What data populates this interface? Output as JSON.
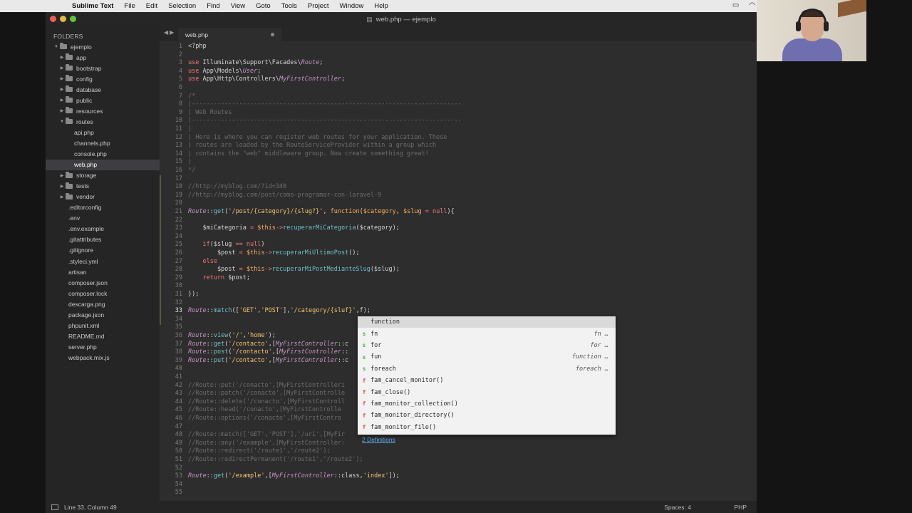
{
  "menubar": {
    "app": "Sublime Text",
    "items": [
      "File",
      "Edit",
      "Selection",
      "Find",
      "View",
      "Goto",
      "Tools",
      "Project",
      "Window",
      "Help"
    ]
  },
  "window": {
    "title": "web.php — ejemplo"
  },
  "sidebar": {
    "header": "FOLDERS",
    "items": [
      {
        "label": "ejemplo",
        "type": "folder",
        "depth": 0,
        "open": true
      },
      {
        "label": "app",
        "type": "folder",
        "depth": 1
      },
      {
        "label": "bootstrap",
        "type": "folder",
        "depth": 1
      },
      {
        "label": "config",
        "type": "folder",
        "depth": 1
      },
      {
        "label": "database",
        "type": "folder",
        "depth": 1
      },
      {
        "label": "public",
        "type": "folder",
        "depth": 1
      },
      {
        "label": "resources",
        "type": "folder",
        "depth": 1
      },
      {
        "label": "routes",
        "type": "folder",
        "depth": 1,
        "open": true
      },
      {
        "label": "api.php",
        "type": "file",
        "depth": 2
      },
      {
        "label": "channels.php",
        "type": "file",
        "depth": 2
      },
      {
        "label": "console.php",
        "type": "file",
        "depth": 2
      },
      {
        "label": "web.php",
        "type": "file",
        "depth": 2,
        "selected": true
      },
      {
        "label": "storage",
        "type": "folder",
        "depth": 1
      },
      {
        "label": "tests",
        "type": "folder",
        "depth": 1
      },
      {
        "label": "vendor",
        "type": "folder",
        "depth": 1
      },
      {
        "label": ".editorconfig",
        "type": "file",
        "depth": 1
      },
      {
        "label": ".env",
        "type": "file",
        "depth": 1
      },
      {
        "label": ".env.example",
        "type": "file",
        "depth": 1
      },
      {
        "label": ".gitattributes",
        "type": "file",
        "depth": 1
      },
      {
        "label": ".gitignore",
        "type": "file",
        "depth": 1
      },
      {
        "label": ".styleci.yml",
        "type": "file",
        "depth": 1
      },
      {
        "label": "artisan",
        "type": "file",
        "depth": 1
      },
      {
        "label": "composer.json",
        "type": "file",
        "depth": 1
      },
      {
        "label": "composer.lock",
        "type": "file",
        "depth": 1
      },
      {
        "label": "descarga.png",
        "type": "file",
        "depth": 1
      },
      {
        "label": "package.json",
        "type": "file",
        "depth": 1
      },
      {
        "label": "phpunit.xml",
        "type": "file",
        "depth": 1
      },
      {
        "label": "README.md",
        "type": "file",
        "depth": 1
      },
      {
        "label": "server.php",
        "type": "file",
        "depth": 1
      },
      {
        "label": "webpack.mix.js",
        "type": "file",
        "depth": 1
      }
    ]
  },
  "tabs": [
    {
      "label": "web.php",
      "active": true,
      "dirty": true
    }
  ],
  "editor": {
    "current_line": 33,
    "lines": [
      {
        "n": 1,
        "tokens": [
          [
            "op",
            "<?php"
          ]
        ]
      },
      {
        "n": 2,
        "tokens": []
      },
      {
        "n": 3,
        "tokens": [
          [
            "kw",
            "use "
          ],
          [
            "op",
            "Illuminate\\Support\\Facades\\"
          ],
          [
            "cls",
            "Route"
          ],
          [
            "op",
            ";"
          ]
        ]
      },
      {
        "n": 4,
        "tokens": [
          [
            "kw",
            "use "
          ],
          [
            "op",
            "App\\Models\\"
          ],
          [
            "cls",
            "User"
          ],
          [
            "op",
            ";"
          ]
        ]
      },
      {
        "n": 5,
        "tokens": [
          [
            "kw",
            "use "
          ],
          [
            "op",
            "App\\Http\\Controllers\\"
          ],
          [
            "cls",
            "MyFirstController"
          ],
          [
            "op",
            ";"
          ]
        ]
      },
      {
        "n": 6,
        "tokens": []
      },
      {
        "n": 7,
        "tokens": [
          [
            "cm",
            "/*"
          ]
        ]
      },
      {
        "n": 8,
        "tokens": [
          [
            "cm",
            "|--------------------------------------------------------------------------"
          ]
        ]
      },
      {
        "n": 9,
        "tokens": [
          [
            "cm",
            "| Web Routes"
          ]
        ]
      },
      {
        "n": 10,
        "tokens": [
          [
            "cm",
            "|--------------------------------------------------------------------------"
          ]
        ]
      },
      {
        "n": 11,
        "tokens": [
          [
            "cm",
            "|"
          ]
        ]
      },
      {
        "n": 12,
        "tokens": [
          [
            "cm",
            "| Here is where you can register web routes for your application. These"
          ]
        ]
      },
      {
        "n": 13,
        "tokens": [
          [
            "cm",
            "| routes are loaded by the RouteServiceProvider within a group which"
          ]
        ]
      },
      {
        "n": 14,
        "tokens": [
          [
            "cm",
            "| contains the \"web\" middleware group. Now create something great!"
          ]
        ]
      },
      {
        "n": 15,
        "tokens": [
          [
            "cm",
            "|"
          ]
        ]
      },
      {
        "n": 16,
        "tokens": [
          [
            "cm",
            "*/"
          ]
        ]
      },
      {
        "n": 17,
        "tokens": []
      },
      {
        "n": 18,
        "tokens": [
          [
            "cm",
            "//http://myblog.com/?id=340"
          ]
        ]
      },
      {
        "n": 19,
        "tokens": [
          [
            "cm",
            "//http://myblog.com/post/como-programar-con-laravel-9"
          ]
        ]
      },
      {
        "n": 20,
        "tokens": []
      },
      {
        "n": 21,
        "tokens": [
          [
            "cls",
            "Route"
          ],
          [
            "op",
            "::"
          ],
          [
            "fn",
            "get"
          ],
          [
            "op",
            "("
          ],
          [
            "str",
            "'/post/{category}/{slug?}'"
          ],
          [
            "op",
            ", "
          ],
          [
            "var",
            "function"
          ],
          [
            "op",
            "("
          ],
          [
            "var",
            "$category"
          ],
          [
            "op",
            ", "
          ],
          [
            "var",
            "$slug"
          ],
          [
            "kw",
            " = "
          ],
          [
            "kw",
            "null"
          ],
          [
            "op",
            "){"
          ]
        ]
      },
      {
        "n": 22,
        "tokens": []
      },
      {
        "n": 23,
        "tokens": [
          [
            "op",
            "    $miCategoria "
          ],
          [
            "kw",
            "= "
          ],
          [
            "var",
            "$this"
          ],
          [
            "kw",
            "->"
          ],
          [
            "fn",
            "recuperarMiCategoria"
          ],
          [
            "op",
            "($category);"
          ]
        ]
      },
      {
        "n": 24,
        "tokens": []
      },
      {
        "n": 25,
        "tokens": [
          [
            "kw",
            "    if"
          ],
          [
            "op",
            "($slug "
          ],
          [
            "kw",
            "== "
          ],
          [
            "kw",
            "null"
          ],
          [
            "op",
            ")"
          ]
        ]
      },
      {
        "n": 26,
        "tokens": [
          [
            "op",
            "        $post "
          ],
          [
            "kw",
            "= "
          ],
          [
            "var",
            "$this"
          ],
          [
            "kw",
            "->"
          ],
          [
            "fn",
            "recuperarMiUltimoPost"
          ],
          [
            "op",
            "();"
          ]
        ]
      },
      {
        "n": 27,
        "tokens": [
          [
            "kw",
            "    else"
          ]
        ]
      },
      {
        "n": 28,
        "tokens": [
          [
            "op",
            "        $post "
          ],
          [
            "kw",
            "= "
          ],
          [
            "var",
            "$this"
          ],
          [
            "kw",
            "->"
          ],
          [
            "fn",
            "recuperarMiPostMedianteSlug"
          ],
          [
            "op",
            "($slug);"
          ]
        ]
      },
      {
        "n": 29,
        "tokens": [
          [
            "kw",
            "    return "
          ],
          [
            "op",
            "$post;"
          ]
        ]
      },
      {
        "n": 30,
        "tokens": []
      },
      {
        "n": 31,
        "tokens": [
          [
            "op",
            "});"
          ]
        ]
      },
      {
        "n": 32,
        "tokens": []
      },
      {
        "n": 33,
        "tokens": [
          [
            "cls",
            "Route"
          ],
          [
            "op",
            "::"
          ],
          [
            "fn",
            "match"
          ],
          [
            "op",
            "(["
          ],
          [
            "str",
            "'GET'"
          ],
          [
            "op",
            ","
          ],
          [
            "str",
            "'POST'"
          ],
          [
            "op",
            "],"
          ],
          [
            "str",
            "'/category/{sluf}'"
          ],
          [
            "op",
            ",f);"
          ]
        ]
      },
      {
        "n": 34,
        "tokens": []
      },
      {
        "n": 35,
        "tokens": []
      },
      {
        "n": 36,
        "tokens": [
          [
            "cls",
            "Route"
          ],
          [
            "op",
            "::"
          ],
          [
            "fn",
            "view"
          ],
          [
            "op",
            "("
          ],
          [
            "str",
            "'/'"
          ],
          [
            "op",
            ","
          ],
          [
            "str",
            "'home'"
          ],
          [
            "op",
            ");"
          ]
        ]
      },
      {
        "n": 37,
        "tokens": [
          [
            "cls",
            "Route"
          ],
          [
            "op",
            "::"
          ],
          [
            "fn",
            "get"
          ],
          [
            "op",
            "("
          ],
          [
            "str",
            "'/contacto'"
          ],
          [
            "op",
            ",["
          ],
          [
            "cls",
            "MyFirstController"
          ],
          [
            "op",
            "::c"
          ]
        ]
      },
      {
        "n": 38,
        "tokens": [
          [
            "cls",
            "Route"
          ],
          [
            "op",
            "::"
          ],
          [
            "fn",
            "post"
          ],
          [
            "op",
            "("
          ],
          [
            "str",
            "'/contacto'"
          ],
          [
            "op",
            ",["
          ],
          [
            "cls",
            "MyFirstController"
          ],
          [
            "op",
            "::"
          ]
        ]
      },
      {
        "n": 39,
        "tokens": [
          [
            "cls",
            "Route"
          ],
          [
            "op",
            "::"
          ],
          [
            "fn",
            "put"
          ],
          [
            "op",
            "("
          ],
          [
            "str",
            "'/contacto'"
          ],
          [
            "op",
            ",["
          ],
          [
            "cls",
            "MyFirstController"
          ],
          [
            "op",
            "::c"
          ]
        ]
      },
      {
        "n": 40,
        "tokens": []
      },
      {
        "n": 41,
        "tokens": []
      },
      {
        "n": 42,
        "tokens": [
          [
            "cm",
            "//Route::put('/conacto',[MyFirstControlleri"
          ]
        ]
      },
      {
        "n": 43,
        "tokens": [
          [
            "cm",
            "//Route::patch('/conacto',[MyFirstControlle"
          ]
        ]
      },
      {
        "n": 44,
        "tokens": [
          [
            "cm",
            "//Route::delete('/conacto',[MyFirstControll"
          ]
        ]
      },
      {
        "n": 45,
        "tokens": [
          [
            "cm",
            "//Route::head('/conacto',[MyFirstControlle"
          ]
        ]
      },
      {
        "n": 46,
        "tokens": [
          [
            "cm",
            "//Route::options('/conacto',[MyFirstContro"
          ]
        ]
      },
      {
        "n": 47,
        "tokens": []
      },
      {
        "n": 48,
        "tokens": [
          [
            "cm",
            "//Route::match(['GET','POST'],'/uri',[MyFir"
          ]
        ]
      },
      {
        "n": 49,
        "tokens": [
          [
            "cm",
            "//Route::any('/example',[MyFirstController:"
          ]
        ]
      },
      {
        "n": 50,
        "tokens": [
          [
            "cm",
            "//Route::redirect('/route1','/route2');"
          ]
        ]
      },
      {
        "n": 51,
        "tokens": [
          [
            "cm",
            "//Route::redirectPermanent('/route1','/route2');"
          ]
        ]
      },
      {
        "n": 52,
        "tokens": []
      },
      {
        "n": 53,
        "tokens": [
          [
            "cls",
            "Route"
          ],
          [
            "op",
            "::"
          ],
          [
            "fn",
            "get"
          ],
          [
            "op",
            "("
          ],
          [
            "str",
            "'/example'"
          ],
          [
            "op",
            ",["
          ],
          [
            "cls",
            "MyFirstController"
          ],
          [
            "op",
            "::class,"
          ],
          [
            "str",
            "'index'"
          ],
          [
            "op",
            "]);"
          ]
        ]
      },
      {
        "n": 54,
        "tokens": []
      },
      {
        "n": 55,
        "tokens": []
      }
    ]
  },
  "autocomplete": {
    "items": [
      {
        "kind": "",
        "name": "function",
        "hint": "",
        "selected": true
      },
      {
        "kind": "s",
        "name": "fn",
        "hint": "fn …"
      },
      {
        "kind": "s",
        "name": "for",
        "hint": "for …"
      },
      {
        "kind": "s",
        "name": "fun",
        "hint": "function …"
      },
      {
        "kind": "s",
        "name": "foreach",
        "hint": "foreach …"
      },
      {
        "kind": "f",
        "name": "fam_cancel_monitor()",
        "hint": ""
      },
      {
        "kind": "f",
        "name": "fam_close()",
        "hint": ""
      },
      {
        "kind": "f",
        "name": "fam_monitor_collection()",
        "hint": ""
      },
      {
        "kind": "f",
        "name": "fam_monitor_directory()",
        "hint": ""
      },
      {
        "kind": "f",
        "name": "fam_monitor_file()",
        "hint": ""
      }
    ],
    "footer": "2 Definitions"
  },
  "statusbar": {
    "position": "Line 33, Column 49",
    "spaces": "Spaces: 4",
    "syntax": "PHP"
  }
}
